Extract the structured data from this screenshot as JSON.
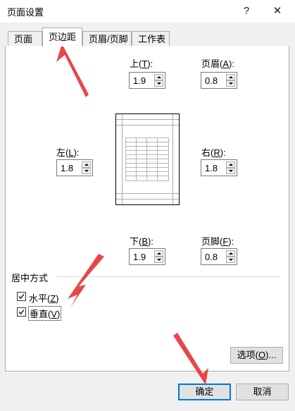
{
  "window": {
    "title": "页面设置",
    "help_symbol": "?",
    "close_symbol": "✕"
  },
  "tabs": [
    "页面",
    "页边距",
    "页眉/页脚",
    "工作表"
  ],
  "active_tab": "页边距",
  "margins": {
    "top": {
      "label_text": "上(",
      "key": "T",
      "label_end": "):",
      "value": "1.9"
    },
    "header": {
      "label_text": "页眉(",
      "key": "A",
      "label_end": "):",
      "value": "0.8"
    },
    "left": {
      "label_text": "左(",
      "key": "L",
      "label_end": "):",
      "value": "1.8"
    },
    "right": {
      "label_text": "右(",
      "key": "R",
      "label_end": "):",
      "value": "1.8"
    },
    "bottom": {
      "label_text": "下(",
      "key": "B",
      "label_end": "):",
      "value": "1.9"
    },
    "footer": {
      "label_text": "页脚(",
      "key": "F",
      "label_end": "):",
      "value": "0.8"
    }
  },
  "center": {
    "group_label": "居中方式",
    "horizontal": {
      "label_text": "水平(",
      "key": "Z",
      "label_end": ")",
      "checked": true
    },
    "vertical": {
      "label_text": "垂直(",
      "key": "V",
      "label_end": ")",
      "checked": true
    }
  },
  "buttons": {
    "options": "选项(",
    "options_key": "O",
    "options_end": ")...",
    "ok": "确定",
    "cancel": "取消"
  },
  "colors": {
    "annotation_arrow": "#e8474a",
    "focus_border": "#0078d7"
  }
}
